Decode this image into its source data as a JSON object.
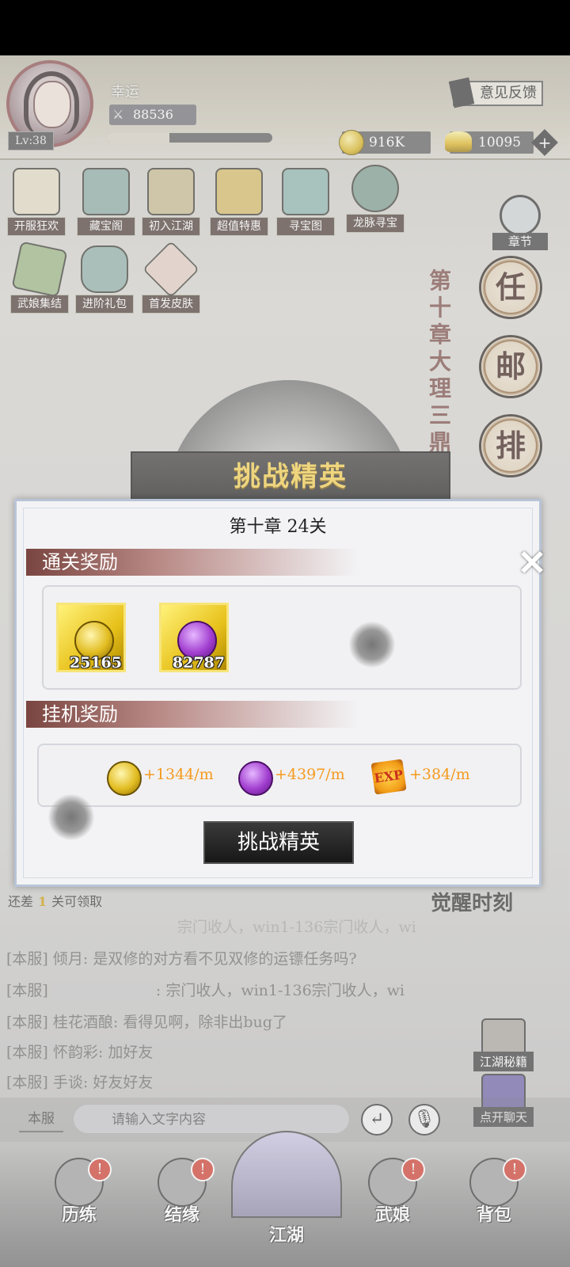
{
  "player": {
    "name": "幸运",
    "level": "Lv:38",
    "power": "88536",
    "exp_fraction": 0.38
  },
  "header": {
    "feedback_label": "意见反馈",
    "coins": "916K",
    "gold": "10095"
  },
  "activities": [
    {
      "label": "开服狂欢",
      "icon": "scroll-icon"
    },
    {
      "label": "藏宝阁",
      "icon": "pavilion-icon"
    },
    {
      "label": "初入江湖",
      "icon": "yin-yang-icon"
    },
    {
      "label": "超值特惠",
      "icon": "treasure-pile-icon"
    },
    {
      "label": "寻宝图",
      "icon": "map-icon"
    },
    {
      "label": "龙脉寻宝",
      "icon": "compass-icon"
    },
    {
      "label": "武娘集结",
      "icon": "ticket-icon"
    },
    {
      "label": "进阶礼包",
      "icon": "gift-bag-icon"
    },
    {
      "label": "首发皮肤",
      "icon": "character-portrait-icon"
    }
  ],
  "side_nav": {
    "chapter_label": "章节",
    "seals": [
      "任",
      "邮",
      "排"
    ]
  },
  "chapter_vertical_title": "第十章大理三鼎第二",
  "elite_banner": "挑战精英",
  "dialog": {
    "title": "第十章  24关",
    "clear_reward_header": "通关奖励",
    "clear_rewards": [
      {
        "icon": "gold-coin-icon",
        "value": "25165"
      },
      {
        "icon": "purple-gem-icon",
        "value": "82787"
      }
    ],
    "idle_reward_header": "挂机奖励",
    "idle_rewards": [
      {
        "icon": "gold-coin-icon",
        "value": "+1344/m"
      },
      {
        "icon": "purple-gem-icon",
        "value": "+4397/m"
      },
      {
        "icon": "exp-star-icon",
        "value": "+384/m"
      }
    ],
    "action_button": "挑战精英",
    "close": "✕"
  },
  "quest_strip": {
    "prefix": "还差",
    "count": "1",
    "suffix": "关可领取"
  },
  "awake_label": "觉醒时刻",
  "chat": {
    "faded_line": "宗门收人，win1-136宗门收人，wi",
    "messages": [
      {
        "server": "[本服]",
        "name": "倾月",
        "text": ": 是双修的对方看不见双修的运镖任务吗?"
      },
      {
        "server": "[本服]",
        "name": "",
        "text": ": 宗门收人，win1-136宗门收人，wi"
      },
      {
        "server": "[本服]",
        "name": "桂花酒酿",
        "text": ": 看得见啊，除非出bug了"
      },
      {
        "server": "[本服]",
        "name": "怀韵彩",
        "text": ": 加好友"
      },
      {
        "server": "[本服]",
        "name": "手谈",
        "text": ": 好友好友"
      }
    ],
    "server_tab": "本服",
    "input_placeholder": "请输入文字内容",
    "open_chat_label": "点开聊天",
    "secrets_label": "江湖秘籍"
  },
  "bottom_nav": [
    {
      "label": "历练",
      "badge": "!"
    },
    {
      "label": "结缘",
      "badge": "!"
    },
    {
      "label": "江湖",
      "badge": ""
    },
    {
      "label": "武娘",
      "badge": "!"
    },
    {
      "label": "背包",
      "badge": "!"
    }
  ],
  "colors": {
    "accent_gold": "#f7d24c",
    "idle_orange": "#f59a1e",
    "badge_red": "#d0392b"
  }
}
